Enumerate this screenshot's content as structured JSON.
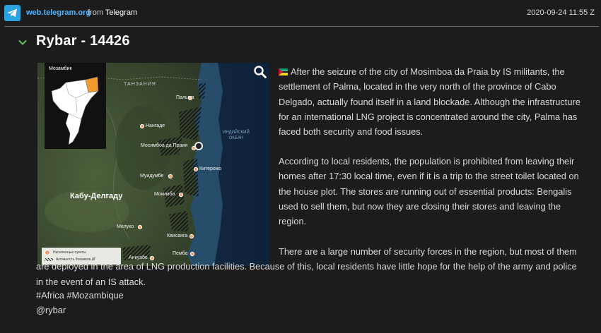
{
  "source": {
    "site": "web.telegram.org",
    "from_prefix": "from",
    "from_name": "Telegram",
    "timestamp": "2020-09-24 11:55 Z"
  },
  "post": {
    "title": "Rybar - 14426",
    "flag_emoji": "mozambique-flag",
    "paragraphs": [
      "After the seizure of the city of Mosimboa da Praia by IS militants, the settlement of Palma, located in the very north of the province of Cabo Delgado, actually found itself in a land blockade. Although the infrastructure for an international LNG project is concentrated around the city, Palma has faced both security and food issues.",
      "According to local residents, the population is prohibited from leaving their homes after 17:30 local time, even if it is a trip to the street toilet located on the house plot. The stores are running out of essential products: Bengalis used to sell them, but now they are closing their stores and leaving the region.",
      "There are a large number of security forces in the region, but most of them are deployed in the area of LNG production facilities. Because of this, local residents have little hope for the help of the army and police in the event of an IS attack."
    ],
    "hashtags": "#Africa #Mozambique",
    "signature": "@rybar"
  },
  "map": {
    "inset_title": "Мозамбик",
    "country_label": "ТАНЗАНИЯ",
    "ocean_label_1": "ИНДИЙСКИЙ",
    "ocean_label_2": "ОКЕАН",
    "region_label": "Кабу-Делгаду",
    "towns": [
      "Пальма",
      "Нангаде",
      "Мосимбоа да Праия",
      "Китерожо",
      "Муидумбе",
      "Мокимба",
      "Мелуко",
      "Квисанга",
      "Анкуабе",
      "Пемба"
    ],
    "legend_settlements": "Населенные пункты",
    "legend_activity": "Активность боевиков ИГ"
  },
  "colors": {
    "accent_link": "#4fb3ff",
    "telegram_blue": "#2aa3e0",
    "chevron_green": "#5cb85c",
    "inset_highlight": "#f29a2e"
  },
  "icons": [
    "telegram-icon",
    "chevron-down-icon",
    "search-icon",
    "mozambique-flag-icon",
    "town-marker-icon",
    "ship-icon"
  ]
}
